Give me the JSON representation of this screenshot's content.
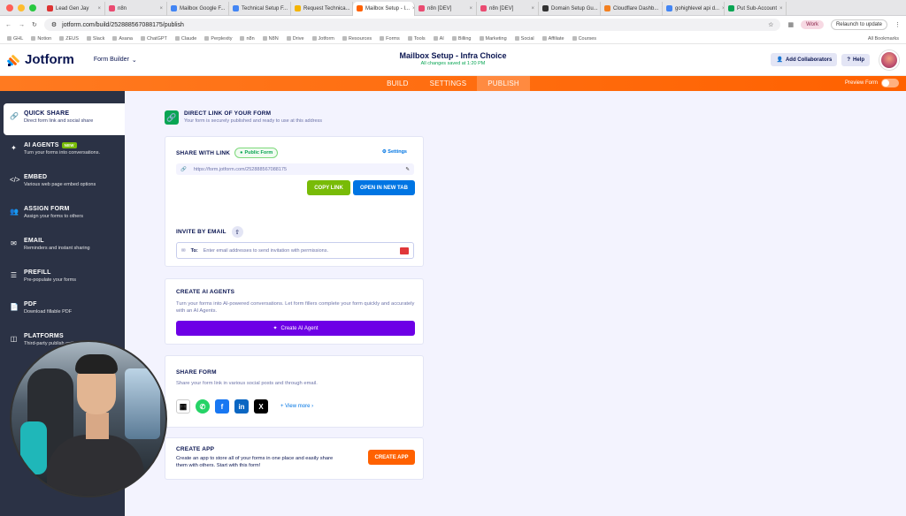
{
  "browser": {
    "tabs": [
      {
        "label": "Lead Gen Jay",
        "color": "#d33"
      },
      {
        "label": "n8n",
        "color": "#ea4b71"
      },
      {
        "label": "Mailbox Google F...",
        "color": "#4285f4"
      },
      {
        "label": "Technical Setup F...",
        "color": "#4285f4"
      },
      {
        "label": "Request Technica...",
        "color": "#f4b400"
      },
      {
        "label": "Mailbox Setup - I...",
        "color": "#ff6100",
        "active": true
      },
      {
        "label": "n8n [DEV]",
        "color": "#ea4b71"
      },
      {
        "label": "n8n [DEV]",
        "color": "#ea4b71"
      },
      {
        "label": "Domain Setup Gu...",
        "color": "#333"
      },
      {
        "label": "Cloudflare Dashb...",
        "color": "#f38020"
      },
      {
        "label": "gohighlevel api d...",
        "color": "#4285f4"
      },
      {
        "label": "Put Sub-Account",
        "color": "#09a553"
      }
    ],
    "url": "jotform.com/build/252888567088175/publish",
    "profile_label": "Work",
    "relaunch_label": "Relaunch to update",
    "bookmarks": [
      "GHL",
      "Notion",
      "ZEUS",
      "Slack",
      "Asana",
      "ChatGPT",
      "Claude",
      "Perplexity",
      "n8n",
      "N8N",
      "Drive",
      "Jotform",
      "Resources",
      "Forms",
      "Tools",
      "AI",
      "Billing",
      "Marketing",
      "Social",
      "Affiliate",
      "Courses"
    ],
    "all_bookmarks_label": "All Bookmarks"
  },
  "header": {
    "logo_text": "Jotform",
    "form_builder_label": "Form Builder",
    "title": "Mailbox Setup - Infra Choice",
    "saved_text": "All changes saved at 1:20 PM",
    "add_collaborators_label": "Add Collaborators",
    "help_label": "Help"
  },
  "nav": {
    "tabs": [
      "BUILD",
      "SETTINGS",
      "PUBLISH"
    ],
    "active_tab": "PUBLISH",
    "preview_label": "Preview Form"
  },
  "sidebar": {
    "items": [
      {
        "title": "QUICK SHARE",
        "desc": "Direct form link and social share",
        "icon": "link-icon"
      },
      {
        "title": "AI AGENTS",
        "desc": "Turn your forms into conversations.",
        "icon": "sparkle-icon",
        "badge": "NEW"
      },
      {
        "title": "EMBED",
        "desc": "Various web page embed options",
        "icon": "code-icon"
      },
      {
        "title": "ASSIGN FORM",
        "desc": "Assign your forms to others",
        "icon": "users-icon"
      },
      {
        "title": "EMAIL",
        "desc": "Reminders and instant sharing",
        "icon": "envelope-icon"
      },
      {
        "title": "PREFILL",
        "desc": "Pre-populate your forms",
        "icon": "prefill-icon"
      },
      {
        "title": "PDF",
        "desc": "Download fillable PDF",
        "icon": "pdf-icon"
      },
      {
        "title": "PLATFORMS",
        "desc": "Third-party publish options",
        "icon": "platforms-icon"
      }
    ]
  },
  "direct_link": {
    "heading": "DIRECT LINK OF YOUR FORM",
    "subheading": "Your form is securely published and ready to use at this address"
  },
  "share_with_link": {
    "label": "SHARE WITH LINK",
    "public_tag": "Public Form",
    "settings_label": "Settings",
    "url": "https://form.jotform.com/252888567088175",
    "copy_label": "COPY LINK",
    "open_label": "OPEN IN NEW TAB",
    "invite_label": "INVITE BY EMAIL",
    "to_label": "To:",
    "email_placeholder": "Enter email addresses to send invitation with permissions."
  },
  "ai_agents": {
    "heading": "CREATE AI AGENTS",
    "text": "Turn your forms into AI-powered conversations. Let form fillers complete your form quickly and accurately with an AI Agents.",
    "button_label": "Create AI Agent"
  },
  "share_form": {
    "heading": "SHARE FORM",
    "text": "Share your form link in various social posts and through email.",
    "view_more_label": "+ View more",
    "socials": [
      "qr-code-icon",
      "whatsapp-icon",
      "facebook-icon",
      "linkedin-icon",
      "x-icon"
    ]
  },
  "create_app": {
    "heading": "CREATE APP",
    "text": "Create an app to store all of your forms in one place and easily share them with others. Start with this form!",
    "button_label": "CREATE APP"
  },
  "colors": {
    "brand_orange": "#ff6100",
    "sidebar_bg": "#2b3245",
    "green": "#78bb07",
    "blue": "#0075e3",
    "purple": "#6d00e6"
  }
}
